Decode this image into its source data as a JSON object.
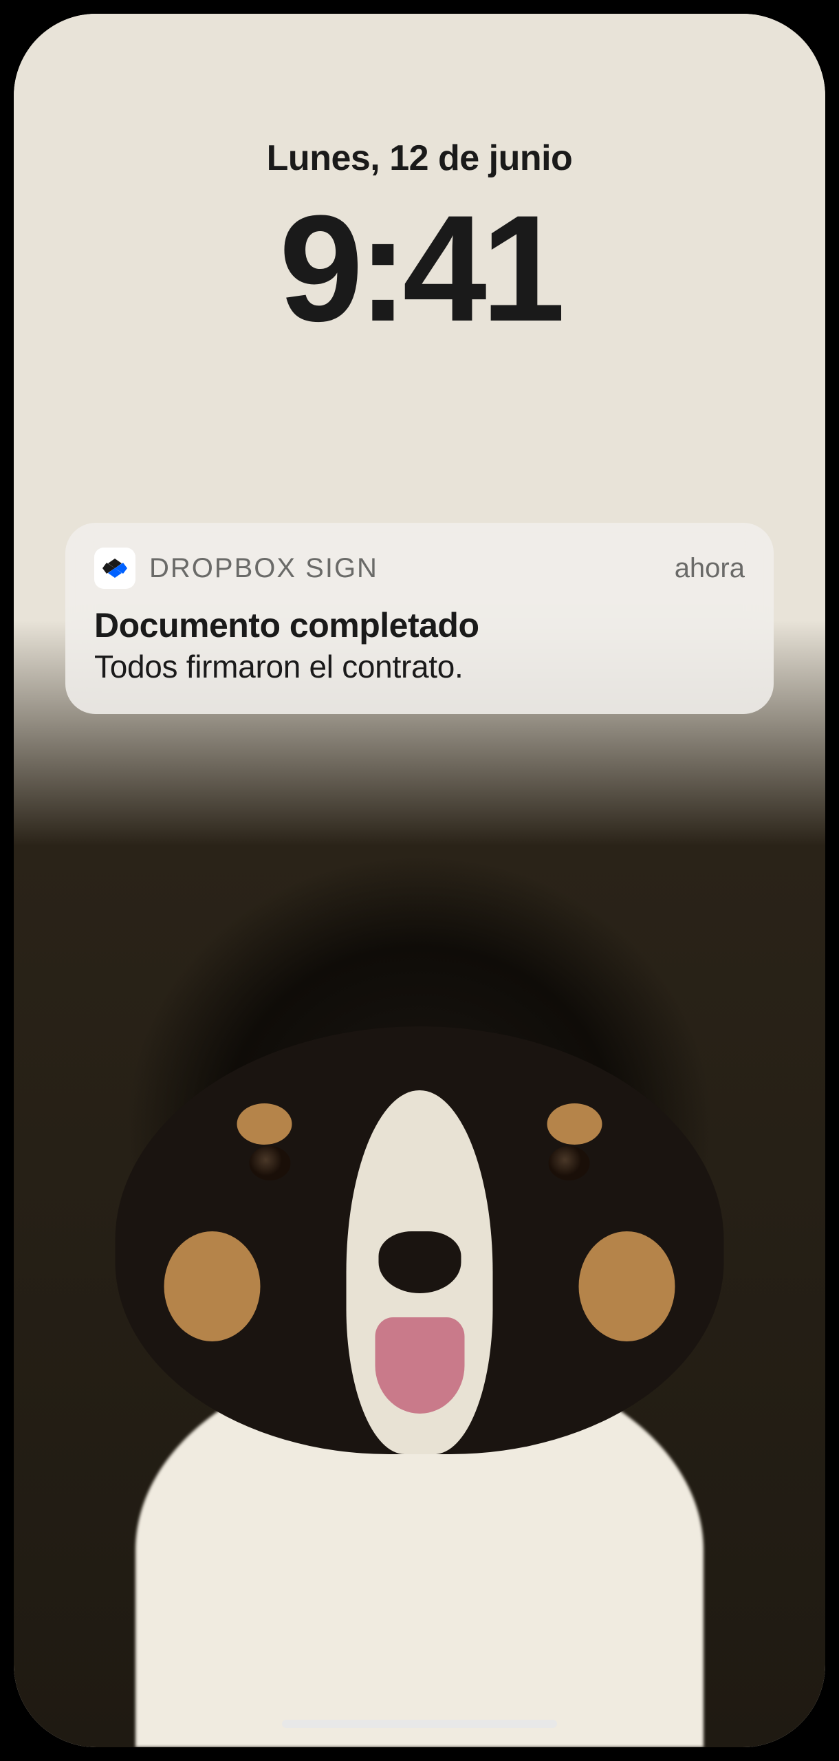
{
  "lockscreen": {
    "date": "Lunes, 12 de junio",
    "time": "9:41"
  },
  "notification": {
    "app_name": "DROPBOX SIGN",
    "timestamp": "ahora",
    "title": "Documento completado",
    "body": "Todos firmaron el contrato.",
    "icon_name": "dropbox-sign-icon"
  }
}
